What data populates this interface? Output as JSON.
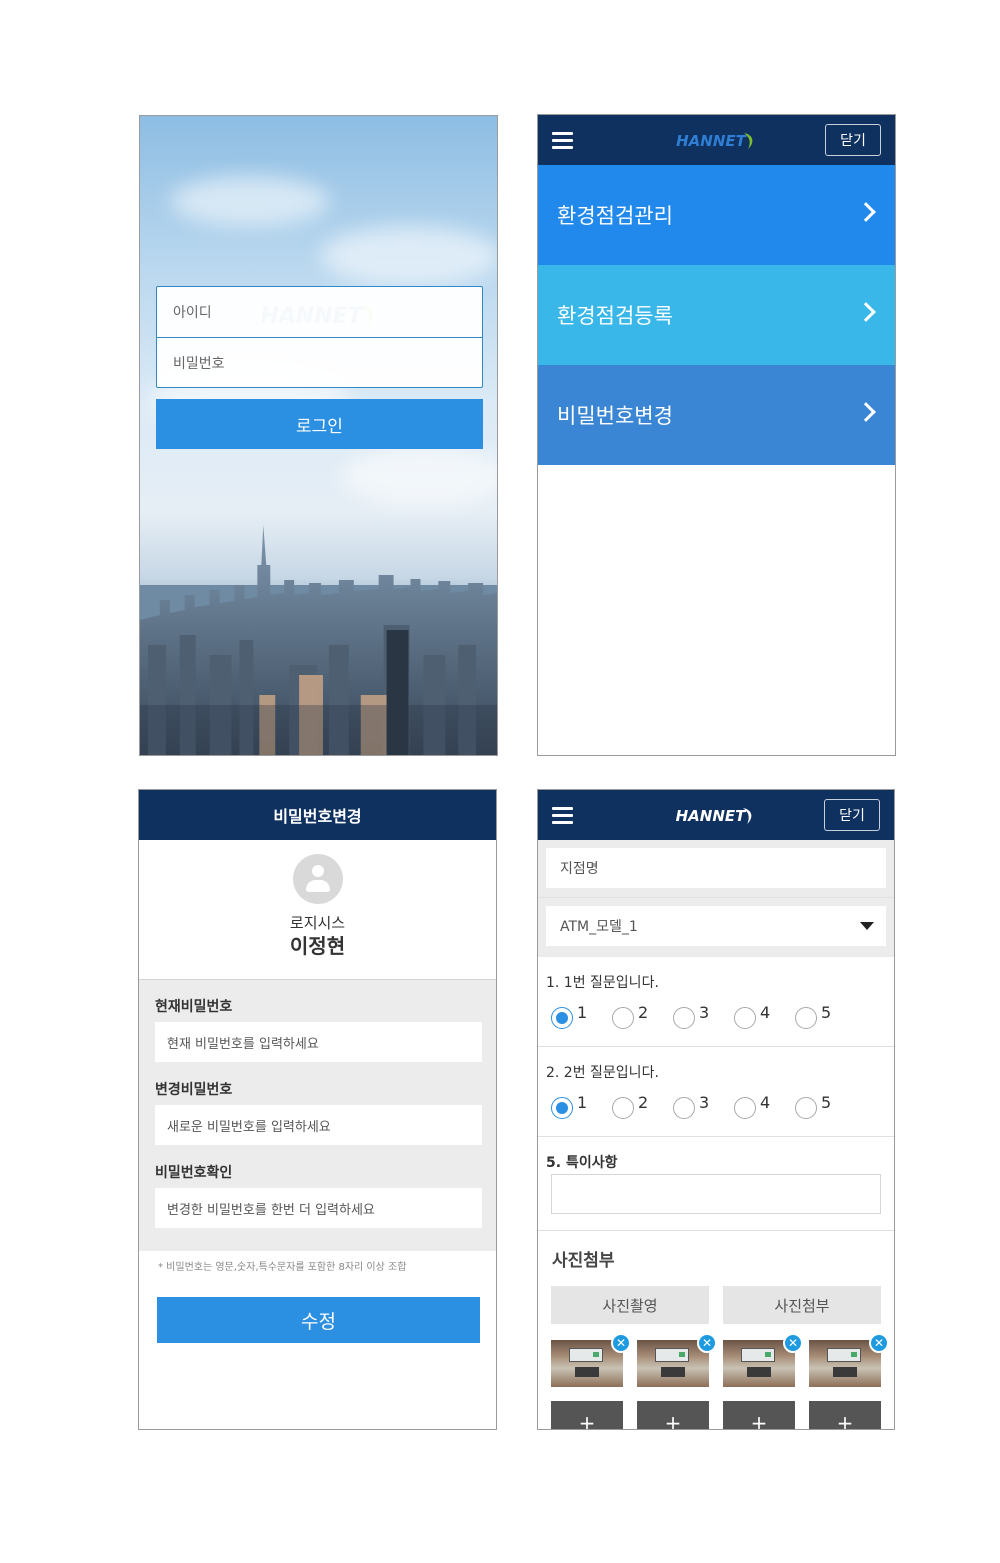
{
  "brand": {
    "logo_text": "HANNET",
    "accent": "#2b8fe2",
    "navy": "#0f3160"
  },
  "login": {
    "id_placeholder": "아이디",
    "pw_placeholder": "비밀번호",
    "login_button": "로그인"
  },
  "header": {
    "close_label": "닫기"
  },
  "menu": {
    "items": [
      {
        "label": "환경점검관리",
        "color": "#2188ec"
      },
      {
        "label": "환경점검등록",
        "color": "#38b7e8"
      },
      {
        "label": "비밀번호변경",
        "color": "#3a86d4"
      }
    ]
  },
  "password": {
    "title": "비밀번호변경",
    "company": "로지시스",
    "name": "이정현",
    "current_label": "현재비밀번호",
    "current_placeholder": "현재 비밀번호를 입력하세요",
    "new_label": "변경비밀번호",
    "new_placeholder": "새로운 비밀번호를 입력하세요",
    "confirm_label": "비밀번호확인",
    "confirm_placeholder": "변경한 비밀번호를 한번 더 입력하세요",
    "rule_note": "* 비밀번호는 영문,숫자,특수문자를 포함한 8자리 이상 조합",
    "submit_label": "수정"
  },
  "form": {
    "branch_placeholder": "지점명",
    "model_selected": "ATM_모델_1",
    "questions": [
      {
        "title": "1.  1번 질문입니다.",
        "options": [
          "1",
          "2",
          "3",
          "4",
          "5"
        ],
        "selected": "1"
      },
      {
        "title": "2.  2번 질문입니다.",
        "options": [
          "1",
          "2",
          "3",
          "4",
          "5"
        ],
        "selected": "1"
      }
    ],
    "remarks_label": "5.  특이사항",
    "photo_section": "사진첨부",
    "take_photo_button": "사진촬영",
    "attach_photo_button": "사진첨부",
    "photo_count": 4,
    "remove_glyph": "✕",
    "add_glyph": "+"
  }
}
